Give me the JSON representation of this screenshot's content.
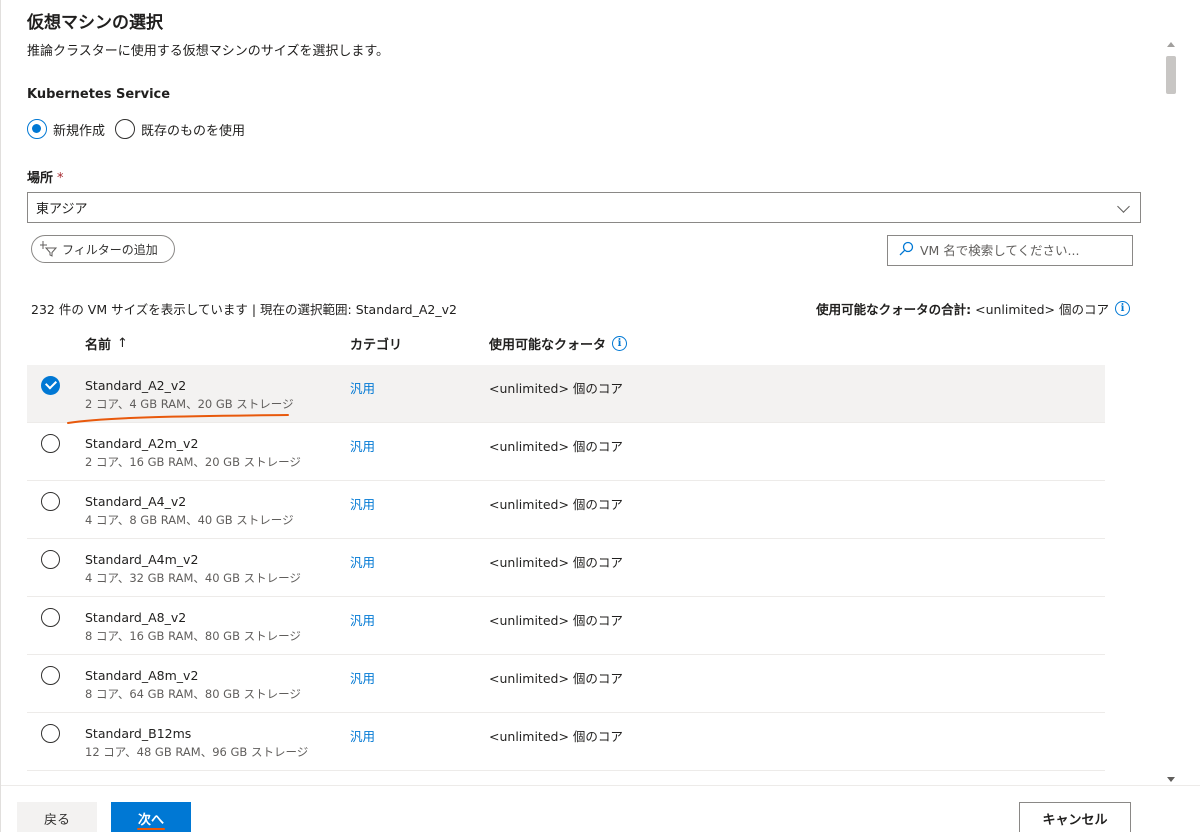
{
  "header": {
    "title": "仮想マシンの選択",
    "subtitle": "推論クラスターに使用する仮想マシンのサイズを選択します。"
  },
  "kubernetes": {
    "label": "Kubernetes Service",
    "options": [
      {
        "label": "新規作成",
        "selected": true
      },
      {
        "label": "既存のものを使用",
        "selected": false
      }
    ]
  },
  "location": {
    "label": "場所",
    "required_mark": "*",
    "value": "東アジア"
  },
  "filter": {
    "add_label": "フィルターの追加"
  },
  "search": {
    "placeholder": "VM 名で検索してください..."
  },
  "summary": {
    "text": "232 件の VM サイズを表示しています | 現在の選択範囲: Standard_A2_v2",
    "quota_label": "使用可能なクォータの合計:",
    "quota_value": "<unlimited> 個のコア"
  },
  "table": {
    "columns": [
      {
        "label": "名前",
        "sort": "↑"
      },
      {
        "label": "カテゴリ"
      },
      {
        "label": "使用可能なクォータ"
      }
    ],
    "rows": [
      {
        "name": "Standard_A2_v2",
        "spec": "2 コア、4 GB RAM、20 GB ストレージ",
        "category": "汎用",
        "quota": "<unlimited> 個のコア",
        "selected": true
      },
      {
        "name": "Standard_A2m_v2",
        "spec": "2 コア、16 GB RAM、20 GB ストレージ",
        "category": "汎用",
        "quota": "<unlimited> 個のコア",
        "selected": false
      },
      {
        "name": "Standard_A4_v2",
        "spec": "4 コア、8 GB RAM、40 GB ストレージ",
        "category": "汎用",
        "quota": "<unlimited> 個のコア",
        "selected": false
      },
      {
        "name": "Standard_A4m_v2",
        "spec": "4 コア、32 GB RAM、40 GB ストレージ",
        "category": "汎用",
        "quota": "<unlimited> 個のコア",
        "selected": false
      },
      {
        "name": "Standard_A8_v2",
        "spec": "8 コア、16 GB RAM、80 GB ストレージ",
        "category": "汎用",
        "quota": "<unlimited> 個のコア",
        "selected": false
      },
      {
        "name": "Standard_A8m_v2",
        "spec": "8 コア、64 GB RAM、80 GB ストレージ",
        "category": "汎用",
        "quota": "<unlimited> 個のコア",
        "selected": false
      },
      {
        "name": "Standard_B12ms",
        "spec": "12 コア、48 GB RAM、96 GB ストレージ",
        "category": "汎用",
        "quota": "<unlimited> 個のコア",
        "selected": false
      },
      {
        "name": "",
        "spec": "",
        "category": "",
        "quota": "",
        "selected": false
      }
    ]
  },
  "footer": {
    "back_label": "戻る",
    "next_label": "次へ",
    "cancel_label": "キャンセル"
  },
  "colors": {
    "accent": "#0078d4",
    "annotation": "#e8590c"
  }
}
